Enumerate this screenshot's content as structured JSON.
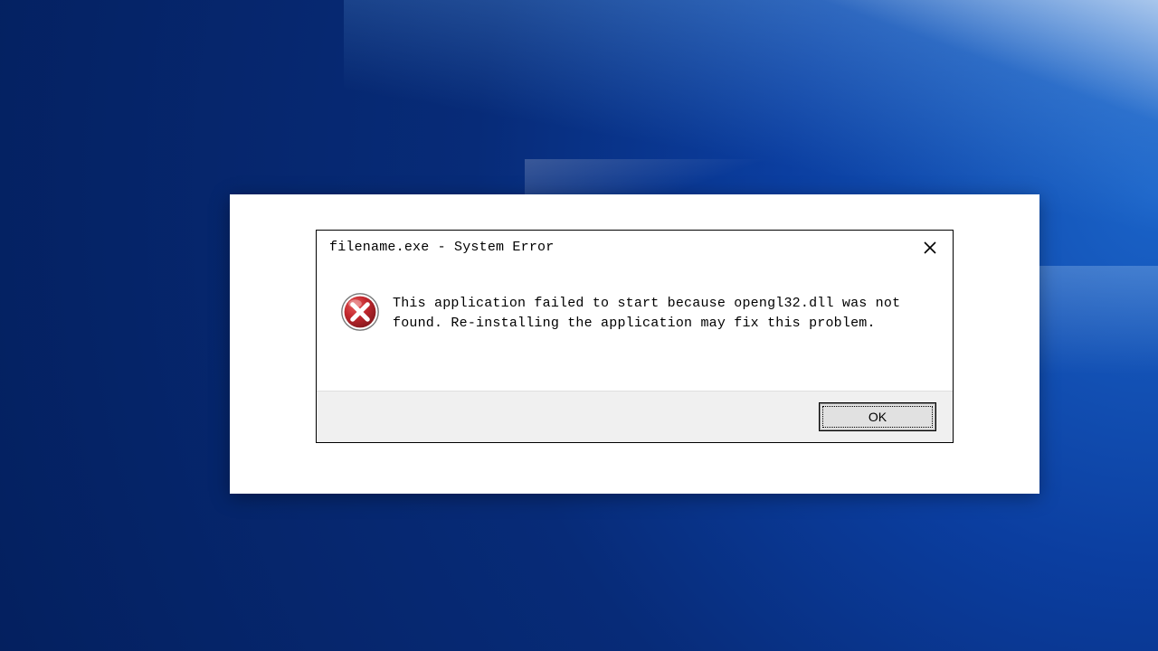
{
  "dialog": {
    "title": "filename.exe - System Error",
    "message": "This application failed to start because opengl32.dll was not found. Re-installing the application may fix this problem.",
    "ok_label": "OK"
  },
  "icons": {
    "error": "error-icon",
    "close": "close-icon"
  },
  "colors": {
    "error_red": "#c1272d",
    "dialog_border": "#000000",
    "footer_bg": "#f0f0f0"
  }
}
